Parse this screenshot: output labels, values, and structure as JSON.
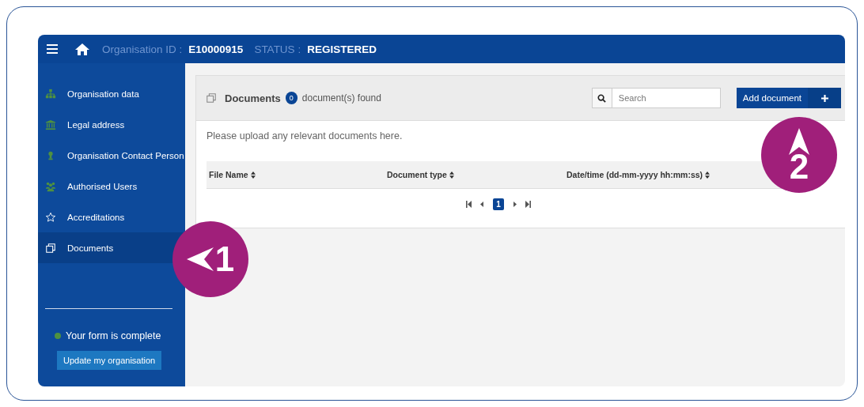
{
  "header": {
    "org_label": "Organisation ID :",
    "org_id": "E10000915",
    "status_label": "STATUS :",
    "status": "REGISTERED"
  },
  "sidebar": {
    "items": [
      {
        "label": "Organisation data",
        "kind": "sitemap",
        "selected": false
      },
      {
        "label": "Legal address",
        "kind": "bank",
        "selected": false
      },
      {
        "label": "Organisation Contact Person",
        "kind": "person",
        "selected": false
      },
      {
        "label": "Authorised Users",
        "kind": "users",
        "selected": false
      },
      {
        "label": "Accreditations",
        "kind": "star",
        "selected": false
      },
      {
        "label": "Documents",
        "kind": "copy",
        "selected": true
      }
    ],
    "form_status": "Your form is complete",
    "update_button": "Update my organisation"
  },
  "documents": {
    "title": "Documents",
    "count": "0",
    "count_label": "document(s) found",
    "search": {
      "placeholder": "Search"
    },
    "add_button": "Add document",
    "intro": "Please upload any relevant documents here.",
    "columns": [
      "File Name",
      "Document type",
      "Date/time (dd-mm-yyyy hh:mm:ss)"
    ],
    "pages": [
      {
        "label": "1",
        "selected": true
      }
    ]
  },
  "annotations": [
    {
      "number": "1",
      "kind": "left"
    },
    {
      "number": "2",
      "kind": "up"
    }
  ]
}
